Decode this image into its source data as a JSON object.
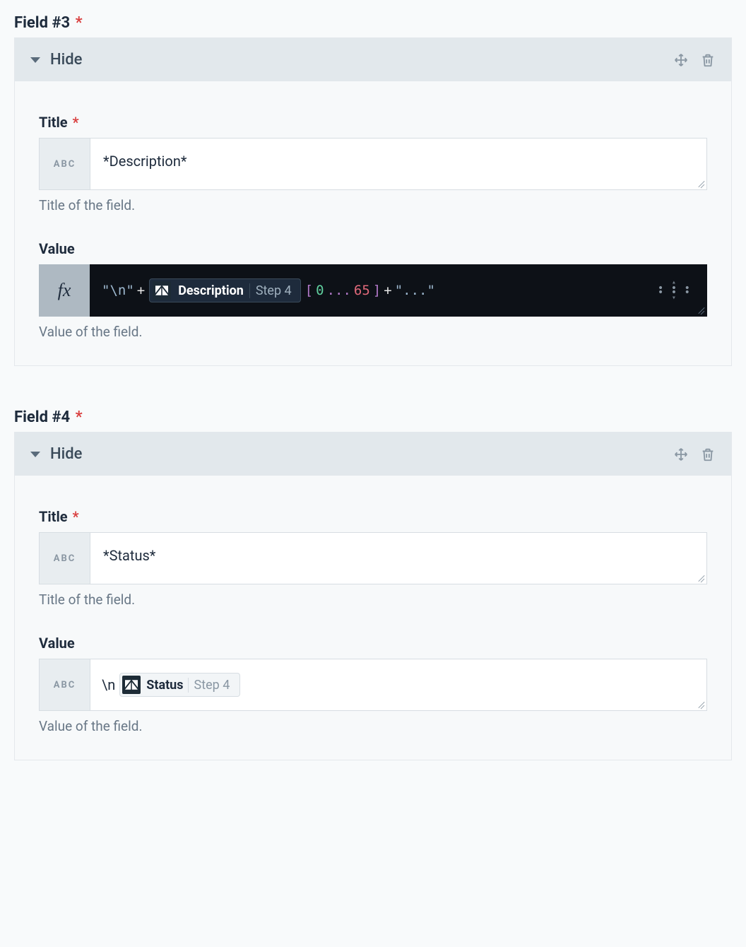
{
  "fields": [
    {
      "header": "Field #3",
      "required": true,
      "collapse_label": "Hide",
      "title": {
        "label": "Title",
        "required": true,
        "prefix": "ABC",
        "value": "*Description*",
        "help": "Title of the field."
      },
      "value": {
        "label": "Value",
        "mode": "formula",
        "prefix": "fx",
        "formula": {
          "leading": "\"\\n\"",
          "plus1": "+",
          "pill_name": "Description",
          "pill_step": "Step 4",
          "open_bracket": "[",
          "slice_start": "0",
          "dots": "...",
          "slice_end": "65",
          "close_bracket": "]",
          "plus2": "+",
          "trailing": "\"...\""
        },
        "help": "Value of the field."
      }
    },
    {
      "header": "Field #4",
      "required": true,
      "collapse_label": "Hide",
      "title": {
        "label": "Title",
        "required": true,
        "prefix": "ABC",
        "value": "*Status*",
        "help": "Title of the field."
      },
      "value": {
        "label": "Value",
        "mode": "text",
        "prefix": "ABC",
        "text_prefix": "\\n",
        "pill_name": "Status",
        "pill_step": "Step 4",
        "help": "Value of the field."
      }
    }
  ]
}
